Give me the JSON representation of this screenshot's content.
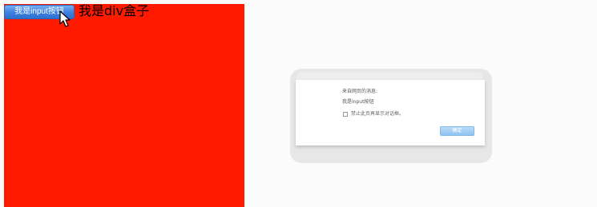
{
  "page": {
    "input_button_label": "我是input按钮",
    "div_text": "我是div盒子"
  },
  "alert_dialog": {
    "title": "来自网页的消息:",
    "message": "我是input按钮",
    "suppress_label": "禁止此页再显示对话框。",
    "ok_label": "确定",
    "suppress_checked": false
  },
  "colors": {
    "red_box": "#ff1a00",
    "button_blue": "#3b7fdf",
    "ok_button": "#8fc2ef"
  },
  "icons": {
    "cursor": "mouse-pointer-icon"
  }
}
